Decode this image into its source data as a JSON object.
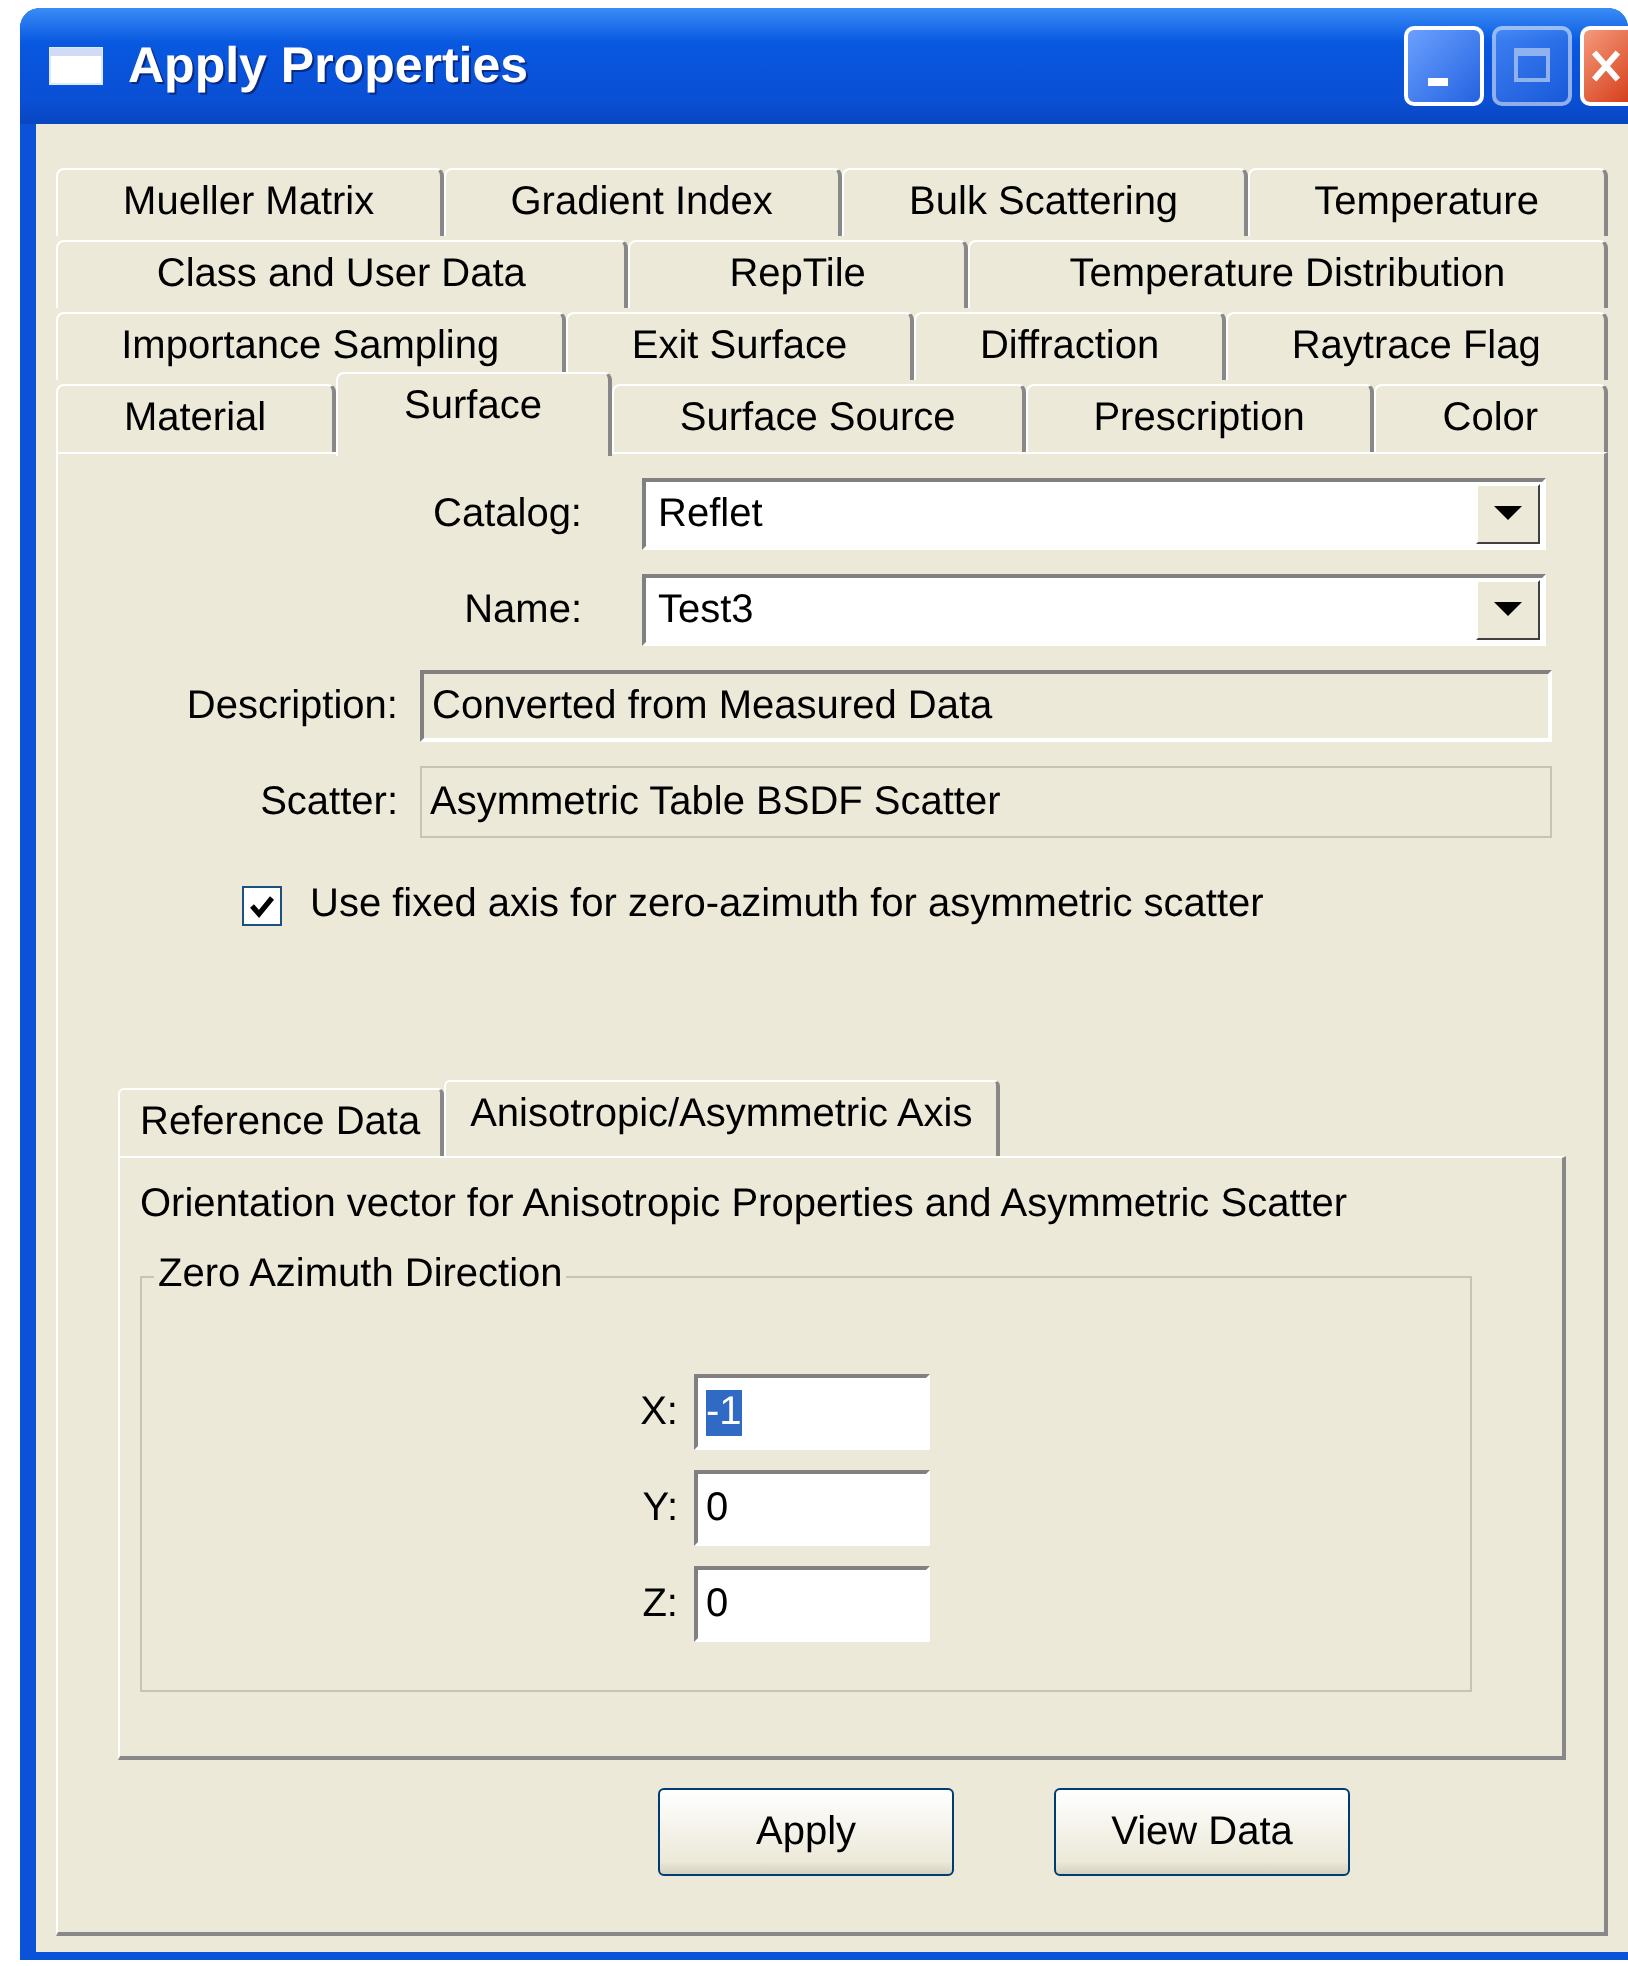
{
  "window": {
    "title": "Apply Properties",
    "controls": [
      {
        "kind": "minimize",
        "disabled": false
      },
      {
        "kind": "maximize",
        "disabled": true
      },
      {
        "kind": "close",
        "disabled": false
      }
    ]
  },
  "tab_rows": [
    {
      "tabs": [
        {
          "label": "Mueller Matrix",
          "selected": false
        },
        {
          "label": "Gradient Index",
          "selected": false
        },
        {
          "label": "Bulk Scattering",
          "selected": false
        },
        {
          "label": "Temperature",
          "selected": false
        }
      ]
    },
    {
      "tabs": [
        {
          "label": "Class and User Data",
          "selected": false
        },
        {
          "label": "RepTile",
          "selected": false
        },
        {
          "label": "Temperature Distribution",
          "selected": false
        }
      ]
    },
    {
      "tabs": [
        {
          "label": "Importance Sampling",
          "selected": false
        },
        {
          "label": "Exit Surface",
          "selected": false
        },
        {
          "label": "Diffraction",
          "selected": false
        },
        {
          "label": "Raytrace Flag",
          "selected": false
        }
      ]
    },
    {
      "tabs": [
        {
          "label": "Material",
          "selected": false
        },
        {
          "label": "Surface",
          "selected": true
        },
        {
          "label": "Surface Source",
          "selected": false
        },
        {
          "label": "Prescription",
          "selected": false
        },
        {
          "label": "Color",
          "selected": false
        }
      ]
    }
  ],
  "fields": [
    {
      "kind": "combo",
      "label": "Catalog:",
      "value": "Reflet"
    },
    {
      "kind": "combo",
      "label": "Name:",
      "value": "Test3"
    },
    {
      "kind": "readonly",
      "label": "Description:",
      "value": "Converted from Measured Data"
    },
    {
      "kind": "readonly",
      "label": "Scatter:",
      "value": "Asymmetric Table BSDF Scatter"
    }
  ],
  "checkbox": {
    "label": "Use fixed axis for zero-azimuth for asymmetric scatter",
    "checked": true
  },
  "sub_tabs": [
    {
      "label": "Reference Data",
      "selected": false
    },
    {
      "label": "Anisotropic/Asymmetric Axis",
      "selected": true
    }
  ],
  "orientation_text": "Orientation vector for Anisotropic Properties and Asymmetric Scatter",
  "group": {
    "title": "Zero Azimuth Direction",
    "fields": [
      {
        "label": "X:",
        "value": "-1",
        "text_selected": true
      },
      {
        "label": "Y:",
        "value": "0",
        "text_selected": false
      },
      {
        "label": "Z:",
        "value": "0",
        "text_selected": false
      }
    ]
  },
  "buttons": [
    "Apply",
    "View Data"
  ]
}
